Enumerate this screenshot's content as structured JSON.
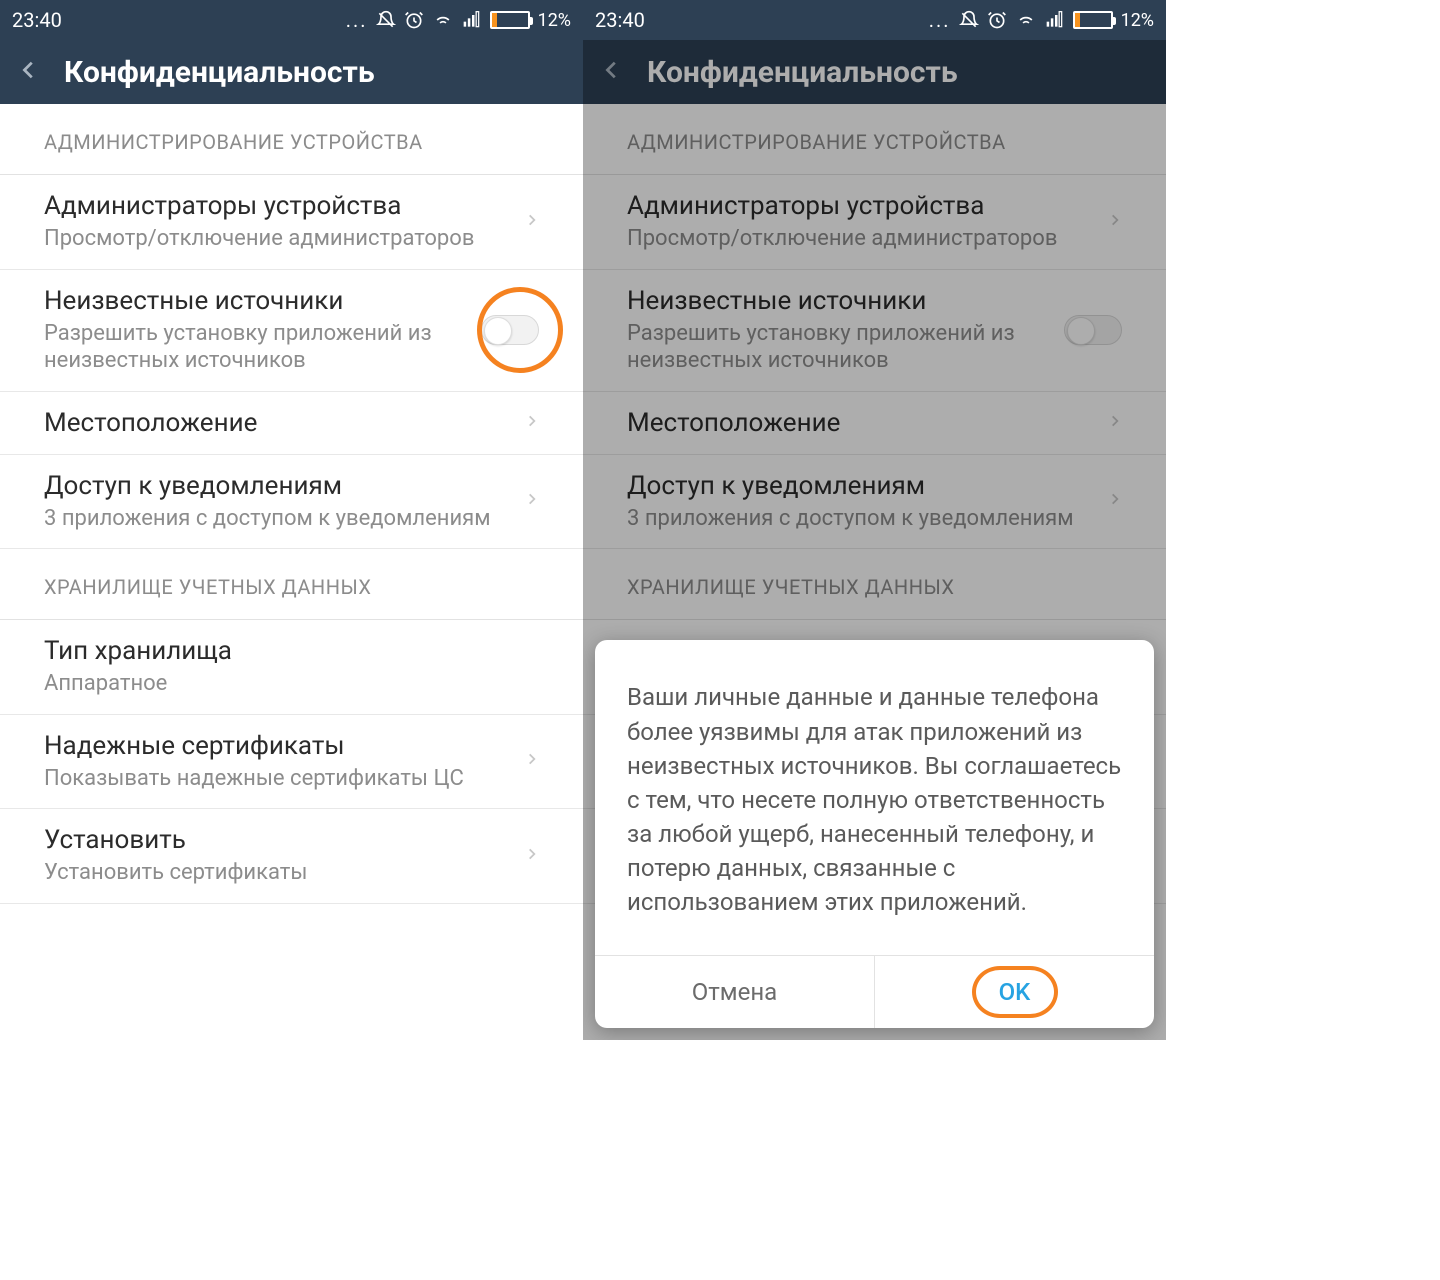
{
  "status": {
    "time": "23:40",
    "battery_pct": "12%"
  },
  "page": {
    "title": "Конфиденциальность"
  },
  "sections": {
    "admin_header": "АДМИНИСТРИРОВАНИЕ УСТРОЙСТВА",
    "storage_header": "ХРАНИЛИЩЕ УЧЕТНЫХ ДАННЫХ"
  },
  "rows": {
    "device_admins": {
      "title": "Администраторы устройства",
      "sub": "Просмотр/отключение администраторов"
    },
    "unknown_sources": {
      "title": "Неизвестные источники",
      "sub": "Разрешить установку приложений из неизвестных источников"
    },
    "location": {
      "title": "Местоположение"
    },
    "notif_access": {
      "title": "Доступ к уведомлениям",
      "sub": "3 приложения с доступом к уведомлениям"
    },
    "storage_type": {
      "title": "Тип хранилища",
      "sub": "Аппаратное"
    },
    "trusted_certs": {
      "title": "Надежные сертификаты",
      "sub": "Показывать надежные сертификаты ЦС"
    },
    "install_certs": {
      "title": "Установить",
      "sub": "Установить сертификаты"
    }
  },
  "dialog": {
    "body": "Ваши личные данные и данные телефона более уязвимы для атак приложений из неизвестных источников. Вы соглашаетесь с тем, что несете полную ответственность за любой ущерб, нанесенный телефону, и потерю данных, связанные с использованием этих приложений.",
    "cancel": "Отмена",
    "ok": "OK"
  }
}
